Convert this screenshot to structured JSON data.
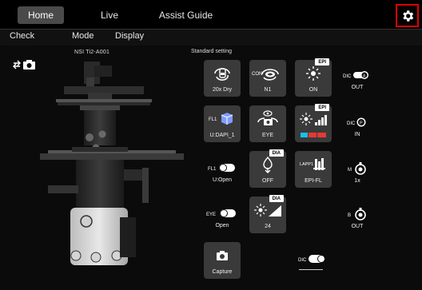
{
  "top_tabs": {
    "home": "Home",
    "live": "Live",
    "assist": "Assist Guide"
  },
  "sub_tabs": {
    "check": "Check",
    "mode": "Mode",
    "display": "Display"
  },
  "model_name": "NSI Ti2-A001",
  "standard_setting": "Standard setting",
  "tiles": {
    "objective": {
      "label": "20x Dry"
    },
    "condenser": {
      "label": "N1",
      "prefix": "CON"
    },
    "epi_shutter": {
      "tag": "EPI",
      "label": "ON"
    },
    "filter_turret": {
      "label": "U:DAPI_1",
      "prefix": "FL1"
    },
    "light_path": {
      "label": "EYE"
    },
    "epi_intensity": {
      "tag": "EPI"
    },
    "dia_shutter": {
      "tag": "DIA",
      "label": "OFF"
    },
    "lapp": {
      "label": "EPI-FL",
      "prefix": "LAPP1"
    },
    "dia_intensity": {
      "tag": "DIA",
      "label": "24"
    },
    "capture": {
      "label": "Capture"
    }
  },
  "side_controls": {
    "dic_a": {
      "prefix": "DIC",
      "letter": "A",
      "label": "OUT"
    },
    "dic_p": {
      "prefix": "DIC",
      "letter": "P",
      "label": "IN"
    },
    "fl1_toggle": {
      "prefix": "FL1",
      "label": "U:Open"
    },
    "mag": {
      "prefix": "M",
      "label": "1x"
    },
    "eye_toggle": {
      "prefix": "EYE",
      "label": "Open"
    },
    "b_knob": {
      "prefix": "B",
      "label": "OUT"
    },
    "dic_toggle": {
      "prefix": "DIC"
    }
  },
  "colors": {
    "accent_red": "#e00000",
    "tile_bg": "#3a3a3a",
    "active_tab": "#4a4a4a"
  },
  "icons": [
    "camera-swap-icon",
    "settings-gear-icon",
    "objective-icon",
    "condenser-icon",
    "epi-lamp-icon",
    "filter-cube-icon",
    "eye-camera-icon",
    "intensity-icon",
    "dia-lamp-icon",
    "lapp-icon",
    "camera-icon",
    "knob-icon",
    "toggle-switch-icon"
  ]
}
